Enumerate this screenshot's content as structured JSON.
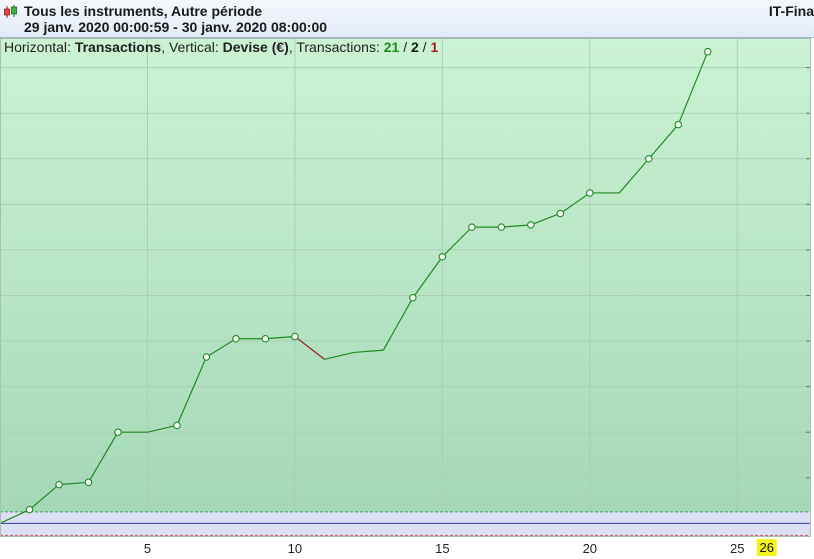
{
  "header": {
    "title": "Tous les instruments, Autre période",
    "period": "29 janv. 2020 00:00:59 - 30 janv. 2020 08:00:00",
    "brand": "IT-Fina"
  },
  "infobar": {
    "horizontal_label": "Horizontal: ",
    "horizontal_value": "Transactions",
    "vertical_label": ", Vertical: ",
    "vertical_value": "Devise (€)",
    "transactions_label": ", Transactions: ",
    "wins": "21",
    "separator": " / ",
    "neutral": "2",
    "losses": "1"
  },
  "chart_data": {
    "type": "line",
    "x": [
      0,
      1,
      2,
      3,
      4,
      5,
      6,
      7,
      8,
      9,
      10,
      11,
      12,
      13,
      14,
      15,
      16,
      17,
      18,
      19,
      20,
      21,
      22,
      23,
      24
    ],
    "y": [
      0,
      6,
      17,
      18,
      40,
      40,
      43,
      73,
      81,
      81,
      82,
      72,
      75,
      76,
      99,
      117,
      130,
      130,
      131,
      136,
      145,
      145,
      160,
      175,
      207
    ],
    "markers": [
      false,
      true,
      true,
      true,
      true,
      false,
      true,
      true,
      true,
      true,
      true,
      false,
      false,
      false,
      true,
      true,
      true,
      true,
      true,
      true,
      true,
      false,
      true,
      true,
      true
    ],
    "xlim": [
      0,
      27.5
    ],
    "ylim": [
      -6,
      213
    ],
    "xticks": [
      5,
      10,
      15,
      20,
      25
    ],
    "xtick_labels": [
      "5",
      "10",
      "15",
      "20",
      "25"
    ],
    "current_x_marker": "26",
    "grid": true,
    "colors": {
      "up_line": "#1f8a1f",
      "down_line": "#a02020",
      "marker_fill": "#ffffff",
      "profit_zone_top": "#cbf3d3",
      "profit_zone_bottom": "#a5d8b8",
      "neutral_band": "#dde0f4",
      "loss_zone": "#d4bcc4",
      "zero_line": "#2c3a9c",
      "upper_band_line": "#3aa04a",
      "lower_band_line": "#c06070",
      "current_marker_bg": "#f3f31c"
    }
  }
}
